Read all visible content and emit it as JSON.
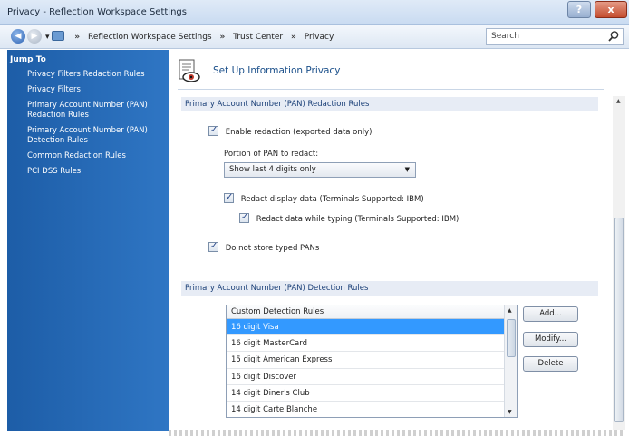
{
  "window": {
    "title": "Privacy - Reflection Workspace Settings",
    "help_glyph": "?",
    "close_glyph": "x"
  },
  "address": {
    "crumbs": [
      "Reflection Workspace Settings",
      "Trust Center",
      "Privacy"
    ],
    "separator": "»",
    "search_placeholder": "Search"
  },
  "sidebar": {
    "heading": "Jump To",
    "items": [
      "Privacy Filters Redaction Rules",
      "Privacy Filters",
      "Primary Account Number (PAN) Redaction Rules",
      "Primary Account Number (PAN) Detection Rules",
      "Common Redaction Rules",
      "PCI DSS Rules"
    ]
  },
  "header": {
    "title": "Set Up Information Privacy"
  },
  "redaction": {
    "section_title": "Primary Account Number (PAN) Redaction Rules",
    "enable_redaction": {
      "label": "Enable redaction (exported data only)",
      "checked": true
    },
    "portion_label": "Portion of PAN to redact:",
    "portion_value": "Show last 4 digits only",
    "redact_display": {
      "label": "Redact display data (Terminals Supported: IBM)",
      "checked": true
    },
    "redact_while_typing": {
      "label": "Redact data while typing (Terminals Supported: IBM)",
      "checked": true
    },
    "do_not_store": {
      "label": "Do not store typed PANs",
      "checked": true
    }
  },
  "detection": {
    "section_title": "Primary Account Number (PAN) Detection Rules",
    "list_header": "Custom Detection Rules",
    "rules": [
      "16 digit Visa",
      "16 digit MasterCard",
      "15 digit American Express",
      "16 digit Discover",
      "14 digit Diner's Club",
      "14 digit Carte Blanche"
    ],
    "selected_index": 0,
    "buttons": {
      "add": "Add...",
      "modify": "Modify...",
      "delete": "Delete"
    }
  },
  "colors": {
    "sidebar": "#2468b5",
    "section_bg": "#e7ecf5",
    "selection": "#3399ff"
  }
}
